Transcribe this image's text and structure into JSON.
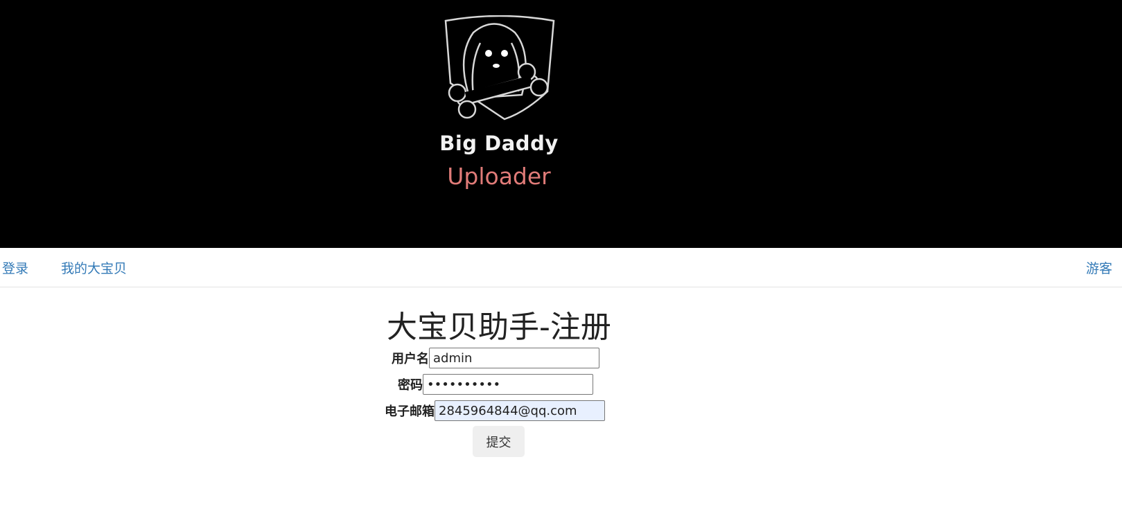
{
  "banner": {
    "logo_title": "Big Daddy",
    "logo_subtitle": "Uploader",
    "logo_icon": "dog-with-bone-shield-icon"
  },
  "nav": {
    "login": "登录",
    "my_baby": "我的大宝贝",
    "guest": "游客"
  },
  "page": {
    "title": "大宝贝助手-注册"
  },
  "form": {
    "username_label": "用户名",
    "username_value": "admin",
    "password_label": "密码",
    "password_value": "••••••••••",
    "email_label": "电子邮箱",
    "email_value": "2845964844@qq.com",
    "submit_label": "提交"
  },
  "colors": {
    "banner_bg": "#000000",
    "subtitle": "#e07b78",
    "link": "#337ab7",
    "autofill_bg": "#e8f0fe"
  }
}
